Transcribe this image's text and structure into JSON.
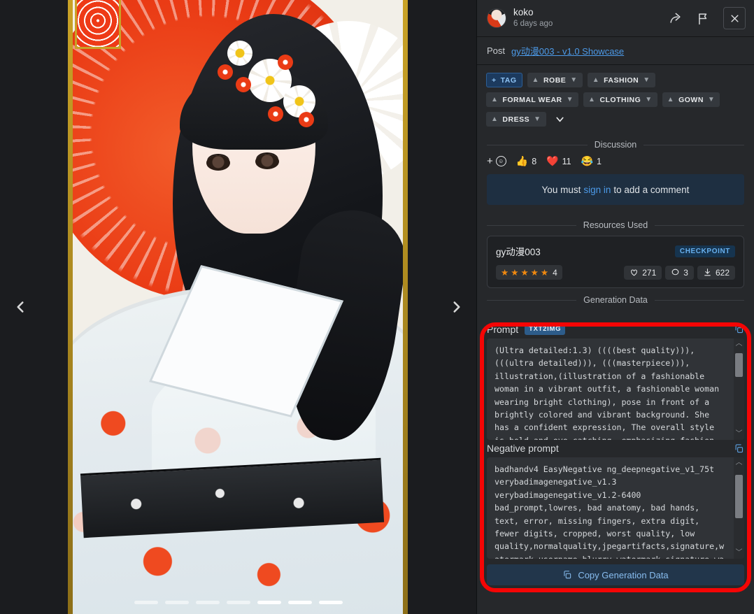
{
  "viewer": {
    "prev_label": "Previous image",
    "next_label": "Next image",
    "indicator_count": 7,
    "active_indicator": 5
  },
  "panel": {
    "user": {
      "name": "koko",
      "time": "6 days ago"
    },
    "actions": {
      "share": "share-icon",
      "report": "flag-icon",
      "close": "close-icon"
    },
    "post": {
      "label": "Post",
      "link": "gy动漫003 - v1.0 Showcase"
    },
    "tags": {
      "add_label": "TAG",
      "items": [
        "ROBE",
        "FASHION",
        "FORMAL WEAR",
        "CLOTHING",
        "GOWN",
        "DRESS"
      ],
      "more_icon": "chevron-down-icon"
    },
    "discussion": {
      "title": "Discussion",
      "reactions": [
        {
          "emoji": "👍",
          "count": "8"
        },
        {
          "emoji": "❤️",
          "count": "11"
        },
        {
          "emoji": "😂",
          "count": "1"
        }
      ],
      "signin_prefix": "You must",
      "signin_link": "sign in",
      "signin_suffix": "to add a comment"
    },
    "resources": {
      "title": "Resources Used",
      "card": {
        "name": "gy动漫003",
        "type_badge": "CHECKPOINT",
        "rating_stars": 5,
        "rating_count": "4",
        "likes": "271",
        "comments": "3",
        "downloads": "622"
      }
    },
    "generation": {
      "title": "Generation Data",
      "prompt_label": "Prompt",
      "prompt_badge": "TXT2IMG",
      "prompt_text": "(Ultra detailed:1.3) ((((best quality))), (((ultra detailed))), (((masterpiece))), illustration,(illustration of a fashionable woman in a vibrant outfit, a fashionable woman wearing bright clothing), pose in front of a brightly colored and vibrant background. She has a confident expression, The overall style is bold and eye-catching, emphasizing fashion",
      "negative_label": "Negative prompt",
      "negative_text": "badhandv4 EasyNegative ng_deepnegative_v1_75t verybadimagenegative_v1.3 verybadimagenegative_v1.2-6400 bad_prompt,lowres, bad anatomy, bad hands, text, error, missing fingers, extra digit, fewer digits, cropped, worst quality, low quality,normalquality,jpegartifacts,signature,watermark,username,blurry,watermark,signature,wa",
      "copy_button": "Copy Generation Data",
      "copy_icon": "copy-icon",
      "highlight_color": "#f50505"
    }
  }
}
